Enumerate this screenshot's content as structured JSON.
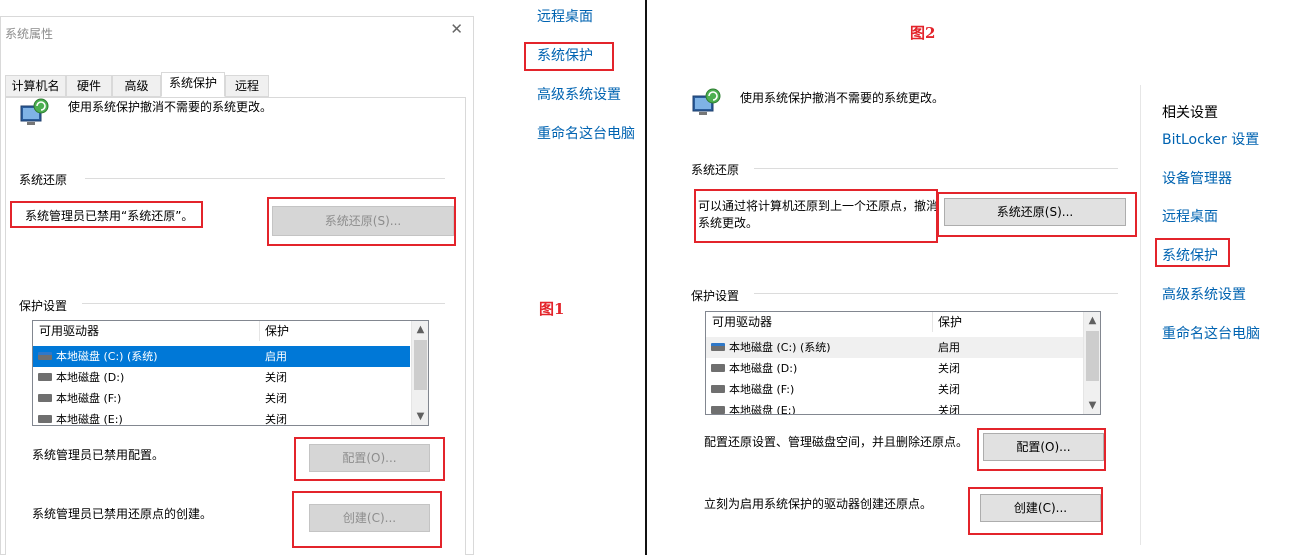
{
  "figure_labels": {
    "fig1": "图1",
    "fig2": "图2"
  },
  "dialog": {
    "title": "系统属性",
    "close_glyph": "✕",
    "tabs": [
      "计算机名",
      "硬件",
      "高级",
      "系统保护",
      "远程"
    ],
    "active_tab": "系统保护"
  },
  "fig1": {
    "intro": "使用系统保护撤消不需要的系统更改。",
    "restore_section": "系统还原",
    "restore_disabled_msg": "系统管理员已禁用“系统还原”。",
    "restore_button": "系统还原(S)...",
    "protection_section": "保护设置",
    "table": {
      "col_drive": "可用驱动器",
      "col_protect": "保护",
      "rows": [
        {
          "drive": "本地磁盘 (C:) (系统)",
          "status": "启用",
          "system": true
        },
        {
          "drive": "本地磁盘 (D:)",
          "status": "关闭",
          "system": false
        },
        {
          "drive": "本地磁盘 (F:)",
          "status": "关闭",
          "system": false
        },
        {
          "drive": "本地磁盘 (E:)",
          "status": "关闭",
          "system": false
        }
      ]
    },
    "config_msg": "系统管理员已禁用配置。",
    "config_button": "配置(O)...",
    "create_msg": "系统管理员已禁用还原点的创建。",
    "create_button": "创建(C)..."
  },
  "links_left": [
    "远程桌面",
    "系统保护",
    "高级系统设置",
    "重命名这台电脑"
  ],
  "fig2": {
    "intro": "使用系统保护撤消不需要的系统更改。",
    "restore_section": "系统还原",
    "restore_desc_line1": "可以通过将计算机还原到上一个还原点，撤消",
    "restore_desc_line2": "系统更改。",
    "restore_button": "系统还原(S)...",
    "protection_section": "保护设置",
    "table": {
      "col_drive": "可用驱动器",
      "col_protect": "保护",
      "rows": [
        {
          "drive": "本地磁盘 (C:) (系统)",
          "status": "启用",
          "system": true
        },
        {
          "drive": "本地磁盘 (D:)",
          "status": "关闭",
          "system": false
        },
        {
          "drive": "本地磁盘 (F:)",
          "status": "关闭",
          "system": false
        },
        {
          "drive": "本地磁盘 (E:)",
          "status": "关闭",
          "system": false
        }
      ]
    },
    "config_msg": "配置还原设置、管理磁盘空间，并且删除还原点。",
    "config_button": "配置(O)...",
    "create_msg": "立刻为启用系统保护的驱动器创建还原点。",
    "create_button": "创建(C)..."
  },
  "related": {
    "heading": "相关设置",
    "links": [
      "BitLocker 设置",
      "设备管理器",
      "远程桌面",
      "系统保护",
      "高级系统设置",
      "重命名这台电脑"
    ]
  },
  "colors": {
    "annotation_red": "#e3242b",
    "link_blue": "#0063b1",
    "selection_blue": "#0078d7"
  },
  "icons": {
    "system_protection": "shield-computer-icon",
    "scroll_up": "chevron-up-icon",
    "scroll_down": "chevron-down-icon",
    "drive": "hard-drive-icon"
  }
}
